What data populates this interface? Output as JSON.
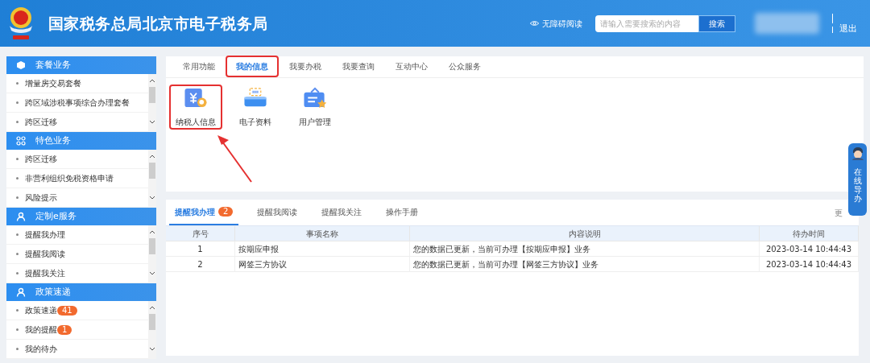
{
  "header": {
    "title": "国家税务总局北京市电子税务局",
    "accessibility": "无障碍阅读",
    "search": {
      "placeholder": "请输入需要搜索的内容",
      "button": "搜索"
    },
    "logout": "退出"
  },
  "sidebar": [
    {
      "title": "套餐业务",
      "kind": "cube",
      "items": [
        {
          "label": "增量房交易套餐"
        },
        {
          "label": "跨区域涉税事项综合办理套餐"
        },
        {
          "label": "跨区迁移"
        }
      ]
    },
    {
      "title": "特色业务",
      "kind": "grid",
      "items": [
        {
          "label": "跨区迁移"
        },
        {
          "label": "非营利组织免税资格申请"
        },
        {
          "label": "风险提示"
        }
      ]
    },
    {
      "title": "定制e服务",
      "kind": "user",
      "items": [
        {
          "label": "提醒我办理"
        },
        {
          "label": "提醒我阅读"
        },
        {
          "label": "提醒我关注"
        }
      ]
    },
    {
      "title": "政策速递",
      "kind": "user",
      "items": [
        {
          "label": "政策速递",
          "badge": "41"
        },
        {
          "label": "我的提醒",
          "badge": "1"
        },
        {
          "label": "我的待办"
        }
      ]
    }
  ],
  "tabs": [
    {
      "label": "常用功能",
      "selected": false,
      "highlighted": false
    },
    {
      "label": "我的信息",
      "selected": true,
      "highlighted": true
    },
    {
      "label": "我要办税",
      "selected": false,
      "highlighted": false
    },
    {
      "label": "我要查询",
      "selected": false,
      "highlighted": false
    },
    {
      "label": "互动中心",
      "selected": false,
      "highlighted": false
    },
    {
      "label": "公众服务",
      "selected": false,
      "highlighted": false
    }
  ],
  "functions": [
    {
      "label": "纳税人信息",
      "kind": "taxpayer",
      "highlighted": true
    },
    {
      "label": "电子资料",
      "kind": "scanner",
      "highlighted": false
    },
    {
      "label": "用户管理",
      "kind": "folder",
      "highlighted": false
    }
  ],
  "reminder_tabs": [
    {
      "label": "提醒我办理",
      "badge": "2",
      "selected": true
    },
    {
      "label": "提醒我阅读",
      "selected": false
    },
    {
      "label": "提醒我关注",
      "selected": false
    },
    {
      "label": "操作手册",
      "selected": false
    }
  ],
  "more": "更",
  "table": {
    "columns": [
      "序号",
      "事项名称",
      "内容说明",
      "待办时间"
    ],
    "rows": [
      [
        "1",
        "按期应申报",
        "您的数据已更新，当前可办理【按期应申报】业务",
        "2023-03-14 10:44:43"
      ],
      [
        "2",
        "网签三方协议",
        "您的数据已更新，当前可办理【网签三方协议】业务",
        "2023-03-14 10:44:43"
      ]
    ]
  },
  "float_widget": {
    "label": "在线导办"
  }
}
